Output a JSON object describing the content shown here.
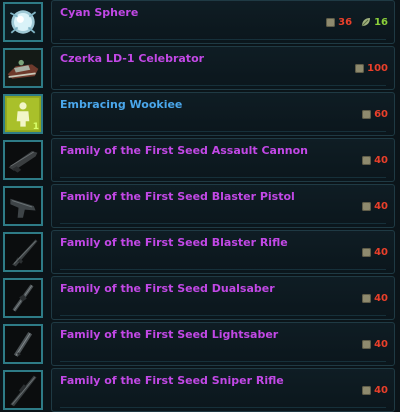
{
  "vendor": {
    "items": [
      {
        "name": "Cyan Sphere",
        "quality": "purple",
        "icon": "cyan-sphere-icon",
        "stack": "",
        "costs": [
          {
            "currency": "coin-icon",
            "amount": "36",
            "color": "#ea3f2a"
          },
          {
            "currency": "leaf-icon",
            "amount": "16",
            "color": "#8bd03a"
          }
        ]
      },
      {
        "name": "Czerka LD-1 Celebrator",
        "quality": "purple",
        "icon": "speeder-icon",
        "stack": "",
        "costs": [
          {
            "currency": "coin-icon",
            "amount": "100",
            "color": "#ea3f2a"
          }
        ]
      },
      {
        "name": "Embracing Wookiee",
        "quality": "blue",
        "icon": "emote-figure-icon",
        "stack": "1",
        "costs": [
          {
            "currency": "coin-icon",
            "amount": "60",
            "color": "#ea3f2a"
          }
        ]
      },
      {
        "name": "Family of the First Seed Assault Cannon",
        "quality": "purple",
        "icon": "assault-cannon-icon",
        "stack": "",
        "costs": [
          {
            "currency": "coin-icon",
            "amount": "40",
            "color": "#ea3f2a"
          }
        ]
      },
      {
        "name": "Family of the First Seed Blaster Pistol",
        "quality": "purple",
        "icon": "blaster-pistol-icon",
        "stack": "",
        "costs": [
          {
            "currency": "coin-icon",
            "amount": "40",
            "color": "#ea3f2a"
          }
        ]
      },
      {
        "name": "Family of the First Seed Blaster Rifle",
        "quality": "purple",
        "icon": "blaster-rifle-icon",
        "stack": "",
        "costs": [
          {
            "currency": "coin-icon",
            "amount": "40",
            "color": "#ea3f2a"
          }
        ]
      },
      {
        "name": "Family of the First Seed Dualsaber",
        "quality": "purple",
        "icon": "dualsaber-icon",
        "stack": "",
        "costs": [
          {
            "currency": "coin-icon",
            "amount": "40",
            "color": "#ea3f2a"
          }
        ]
      },
      {
        "name": "Family of the First Seed Lightsaber",
        "quality": "purple",
        "icon": "lightsaber-icon",
        "stack": "",
        "costs": [
          {
            "currency": "coin-icon",
            "amount": "40",
            "color": "#ea3f2a"
          }
        ]
      },
      {
        "name": "Family of the First Seed Sniper Rifle",
        "quality": "purple",
        "icon": "sniper-rifle-icon",
        "stack": "",
        "costs": [
          {
            "currency": "coin-icon",
            "amount": "40",
            "color": "#ea3f2a"
          }
        ]
      }
    ]
  },
  "colors": {
    "purple_quality": "#c248e6",
    "blue_quality": "#4aa7ec",
    "insufficient_cost": "#ea3f2a",
    "sufficient_cost": "#8bd03a"
  }
}
